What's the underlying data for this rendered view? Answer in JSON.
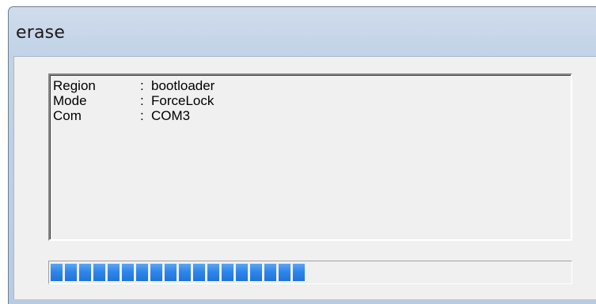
{
  "window": {
    "title": "erase"
  },
  "log": {
    "lines": [
      {
        "key": "Region",
        "value": "bootloader"
      },
      {
        "key": "Mode",
        "value": "ForceLock"
      },
      {
        "key": "Com",
        "value": "COM3"
      }
    ],
    "separator": ":"
  },
  "progress": {
    "value_percent": 50
  },
  "colors": {
    "progress_fill": "#2f86ea",
    "title_gradient_top": "#cfdcec",
    "client_background": "#f0f0f0"
  }
}
